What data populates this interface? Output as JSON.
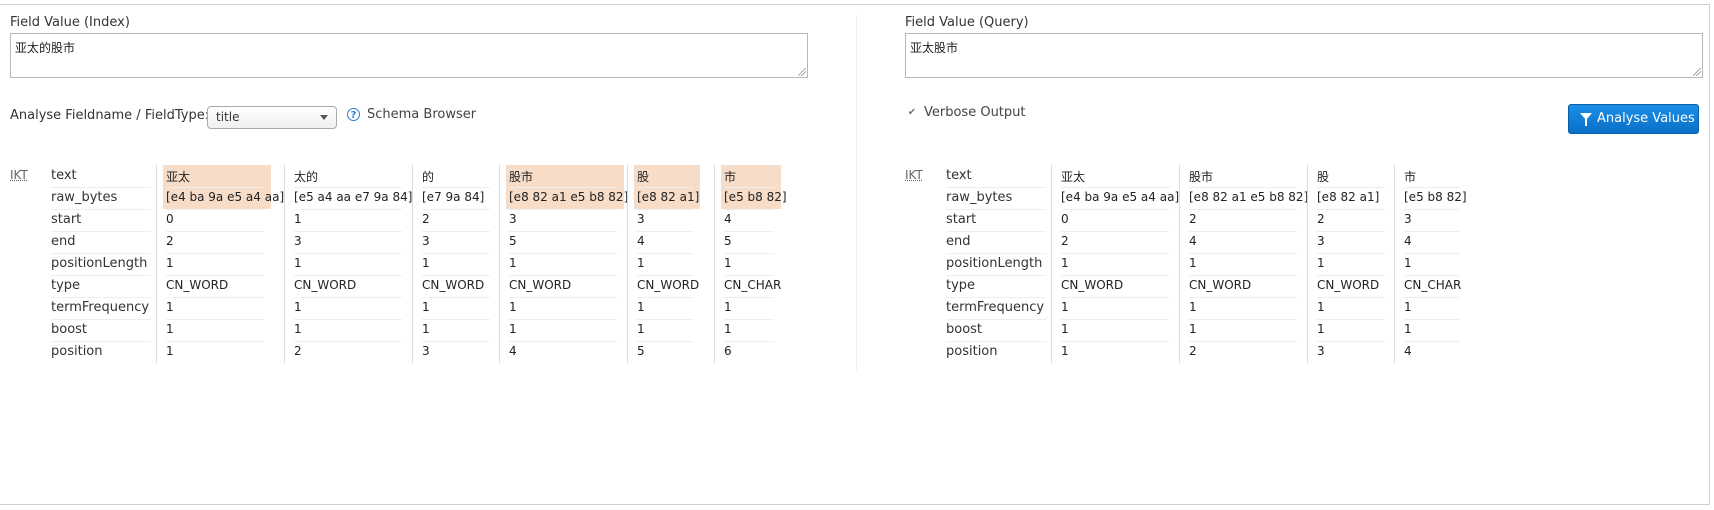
{
  "index": {
    "label": "Field Value (Index)",
    "value": "亚太的股市"
  },
  "query": {
    "label": "Field Value (Query)",
    "value": "亚太股市"
  },
  "fieldtype": {
    "label": "Analyse Fieldname / FieldType:",
    "selected": "title",
    "schema_browser": "Schema Browser",
    "help_icon": "?"
  },
  "verbose": {
    "label": "Verbose Output",
    "checked": true,
    "check_glyph": "✔"
  },
  "analyse_button": "Analyse Values",
  "tokenizer": "IKT",
  "row_labels": [
    "text",
    "raw_bytes",
    "start",
    "end",
    "positionLength",
    "type",
    "termFrequency",
    "boost",
    "position"
  ],
  "index_tokens": [
    {
      "text": "亚太",
      "raw_bytes": "[e4 ba 9a e5 a4 aa]",
      "start": "0",
      "end": "2",
      "positionLength": "1",
      "type": "CN_WORD",
      "termFrequency": "1",
      "boost": "1",
      "position": "1",
      "match": true
    },
    {
      "text": "太的",
      "raw_bytes": "[e5 a4 aa e7 9a 84]",
      "start": "1",
      "end": "3",
      "positionLength": "1",
      "type": "CN_WORD",
      "termFrequency": "1",
      "boost": "1",
      "position": "2",
      "match": false
    },
    {
      "text": "的",
      "raw_bytes": "[e7 9a 84]",
      "start": "2",
      "end": "3",
      "positionLength": "1",
      "type": "CN_WORD",
      "termFrequency": "1",
      "boost": "1",
      "position": "3",
      "match": false
    },
    {
      "text": "股市",
      "raw_bytes": "[e8 82 a1 e5 b8 82]",
      "start": "3",
      "end": "5",
      "positionLength": "1",
      "type": "CN_WORD",
      "termFrequency": "1",
      "boost": "1",
      "position": "4",
      "match": true
    },
    {
      "text": "股",
      "raw_bytes": "[e8 82 a1]",
      "start": "3",
      "end": "4",
      "positionLength": "1",
      "type": "CN_WORD",
      "termFrequency": "1",
      "boost": "1",
      "position": "5",
      "match": true
    },
    {
      "text": "市",
      "raw_bytes": "[e5 b8 82]",
      "start": "4",
      "end": "5",
      "positionLength": "1",
      "type": "CN_CHAR",
      "termFrequency": "1",
      "boost": "1",
      "position": "6",
      "match": true
    }
  ],
  "query_tokens": [
    {
      "text": "亚太",
      "raw_bytes": "[e4 ba 9a e5 a4 aa]",
      "start": "0",
      "end": "2",
      "positionLength": "1",
      "type": "CN_WORD",
      "termFrequency": "1",
      "boost": "1",
      "position": "1"
    },
    {
      "text": "股市",
      "raw_bytes": "[e8 82 a1 e5 b8 82]",
      "start": "2",
      "end": "4",
      "positionLength": "1",
      "type": "CN_WORD",
      "termFrequency": "1",
      "boost": "1",
      "position": "2"
    },
    {
      "text": "股",
      "raw_bytes": "[e8 82 a1]",
      "start": "2",
      "end": "3",
      "positionLength": "1",
      "type": "CN_WORD",
      "termFrequency": "1",
      "boost": "1",
      "position": "3"
    },
    {
      "text": "市",
      "raw_bytes": "[e5 b8 82]",
      "start": "3",
      "end": "4",
      "positionLength": "1",
      "type": "CN_CHAR",
      "termFrequency": "1",
      "boost": "1",
      "position": "4"
    }
  ],
  "colors": {
    "match_highlight": "#f7dcc8",
    "button": "#0a7ad8"
  }
}
